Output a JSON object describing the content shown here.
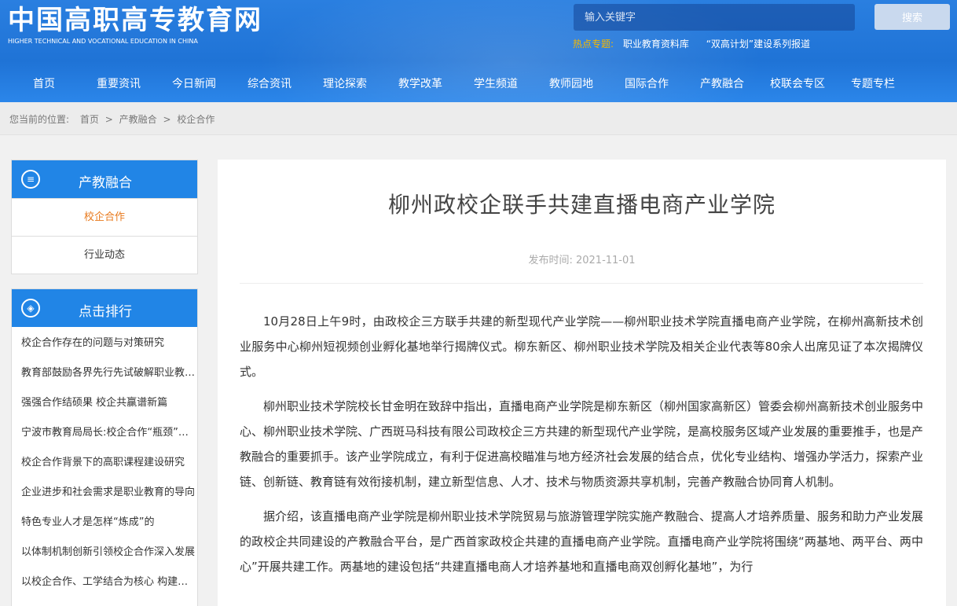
{
  "header": {
    "logo_cn": "中国高职高专教育网",
    "logo_en": "HIGHER TECHNICAL AND VOCATIONAL EDUCATION IN CHINA",
    "search_placeholder": "输入关键字",
    "search_button": "搜索",
    "hot_label": "热点专题:",
    "hot_links": [
      "职业教育资料库",
      "“双高计划”建设系列报道"
    ]
  },
  "nav": [
    "首页",
    "重要资讯",
    "今日新闻",
    "综合资讯",
    "理论探索",
    "教学改革",
    "学生频道",
    "教师园地",
    "国际合作",
    "产教融合",
    "校联会专区",
    "专题专栏"
  ],
  "breadcrumb": {
    "prefix": "您当前的位置:",
    "items": [
      "首页",
      ">",
      "产教融合",
      ">",
      "校企合作"
    ]
  },
  "sidebar": {
    "section_title": "产教融合",
    "subitems": [
      {
        "label": "校企合作",
        "active": true
      },
      {
        "label": "行业动态",
        "active": false
      }
    ],
    "rank_title": "点击排行",
    "rank_items": [
      "校企合作存在的问题与对策研究",
      "教育部鼓励各界先行先试破解职业教育发展难题",
      "强强合作结硕果 校企共赢谱新篇",
      "宁波市教育局局长:校企合作“瓶颈”亟待破解",
      "校企合作背景下的高职课程建设研究",
      "企业进步和社会需求是职业教育的导向",
      "特色专业人才是怎样“炼成”的",
      "以体制机制创新引领校企合作深入发展",
      "以校企合作、工学结合为核心 构建人才培养模式"
    ]
  },
  "article": {
    "title": "柳州政校企联手共建直播电商产业学院",
    "date_label": "发布时间:",
    "date": "2021-11-01",
    "paragraphs": [
      "10月28日上午9时，由政校企三方联手共建的新型现代产业学院——柳州职业技术学院直播电商产业学院，在柳州高新技术创业服务中心柳州短视频创业孵化基地举行揭牌仪式。柳东新区、柳州职业技术学院及相关企业代表等80余人出席见证了本次揭牌仪式。",
      "柳州职业技术学院校长甘金明在致辞中指出，直播电商产业学院是柳东新区（柳州国家高新区）管委会柳州高新技术创业服务中心、柳州职业技术学院、广西斑马科技有限公司政校企三方共建的新型现代产业学院，是高校服务区域产业发展的重要推手，也是产教融合的重要抓手。该产业学院成立，有利于促进高校瞄准与地方经济社会发展的结合点，优化专业结构、增强办学活力，探索产业链、创新链、教育链有效衔接机制，建立新型信息、人才、技术与物质资源共享机制，完善产教融合协同育人机制。",
      "据介绍，该直播电商产业学院是柳州职业技术学院贸易与旅游管理学院实施产教融合、提高人才培养质量、服务和助力产业发展的政校企共同建设的产教融合平台，是广西首家政校企共建的直播电商产业学院。直播电商产业学院将围绕“两基地、两平台、两中心”开展共建工作。两基地的建设包括“共建直播电商人才培养基地和直播电商双创孵化基地”，为行"
    ]
  },
  "colors": {
    "header_blue": "#2185e6",
    "active_orange": "#e8791c",
    "hot_yellow": "#f5b800"
  }
}
